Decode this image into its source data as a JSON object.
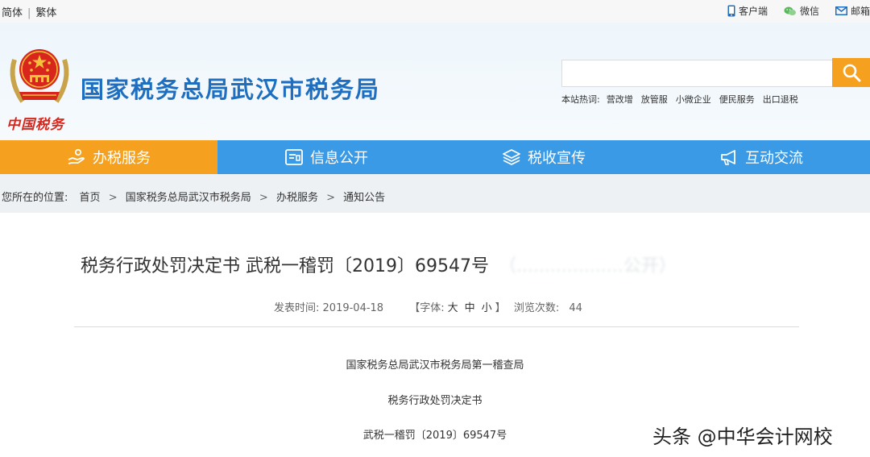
{
  "topbar": {
    "lang_simplified": "简体",
    "lang_separator": "|",
    "lang_traditional": "繁体",
    "client": "客户端",
    "wechat": "微信",
    "mail": "邮箱"
  },
  "header": {
    "emblem_caption": "中国税务",
    "site_title": "国家税务总局武汉市税务局",
    "search_placeholder": "",
    "hot_label": "本站热词:",
    "hot_words": [
      "营改增",
      "放管服",
      "小微企业",
      "便民服务",
      "出口退税"
    ]
  },
  "nav": {
    "items": [
      {
        "label": "办税服务",
        "icon": "hand-service-icon",
        "active": true
      },
      {
        "label": "信息公开",
        "icon": "id-card-icon",
        "active": false
      },
      {
        "label": "税收宣传",
        "icon": "layers-icon",
        "active": false
      },
      {
        "label": "互动交流",
        "icon": "megaphone-icon",
        "active": false
      }
    ]
  },
  "breadcrumb": {
    "label": "您所在的位置:",
    "items": [
      "首页",
      "国家税务总局武汉市税务局",
      "办税服务",
      "通知公告"
    ],
    "separator": ">"
  },
  "article": {
    "title": "税务行政处罚决定书 武税一稽罚〔2019〕69547号",
    "title_suffix": "（...................公开）",
    "publish_label": "发表时间:",
    "publish_date": "2019-04-18",
    "font_label": "【字体:",
    "font_sizes": [
      "大",
      "中",
      "小"
    ],
    "font_close": "】",
    "views_label": "浏览次数:",
    "views": "44",
    "paragraphs": [
      "国家税务总局武汉市税务局第一稽查局",
      "税务行政处罚决定书",
      "武税一稽罚〔2019〕69547号"
    ]
  },
  "watermark": "头条 @中华会计网校",
  "colors": {
    "brand_blue": "#1f6fc1",
    "nav_blue": "#3a9ae6",
    "accent_orange": "#f5a11f"
  }
}
